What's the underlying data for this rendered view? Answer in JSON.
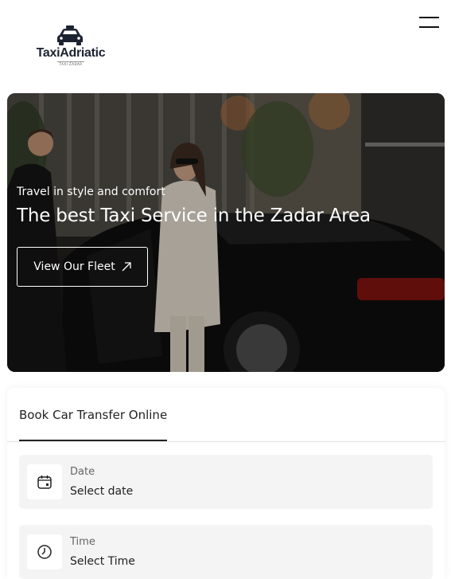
{
  "header": {
    "logo_text": "TaxiAdriatic",
    "logo_subtext": "TAXI ZADAR",
    "menu_icon": "hamburger-menu-icon"
  },
  "hero": {
    "subtitle": "Travel in style and comfort",
    "title": "The best Taxi Service in the Zadar Area",
    "button_label": "View Our Fleet",
    "button_icon": "arrow-up-right-icon"
  },
  "booking": {
    "tab_label": "Book Car Transfer Online",
    "fields": [
      {
        "label": "Date",
        "value": "Select date",
        "icon": "calendar-icon"
      },
      {
        "label": "Time",
        "value": "Select Time",
        "icon": "clock-icon"
      }
    ]
  }
}
